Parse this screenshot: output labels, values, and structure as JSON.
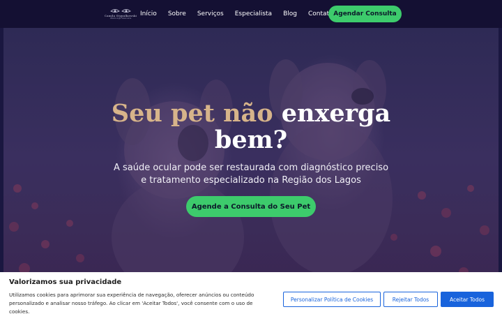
{
  "brand": {
    "logo_text": "Camila Stypulkowski",
    "logo_subtext": "Oftalmologia Veterinária"
  },
  "nav": {
    "items": [
      {
        "label": "Início"
      },
      {
        "label": "Sobre"
      },
      {
        "label": "Serviços"
      },
      {
        "label": "Especialista"
      },
      {
        "label": "Blog"
      },
      {
        "label": "Contato"
      }
    ],
    "cta_label": "Agendar Consulta"
  },
  "hero": {
    "title_accent": "Seu pet não",
    "title_rest_1": "enxerga",
    "title_rest_2": "bem?",
    "subtitle": "A saúde ocular pode ser restaurada com diagnóstico preciso e tratamento especializado na Região dos Lagos",
    "cta_label": "Agende a Consulta do Seu Pet",
    "background_image": "two-golden-retriever-puppies-in-flower-field"
  },
  "cookie_banner": {
    "title": "Valorizamos sua privacidade",
    "text": "Utilizamos cookies para aprimorar sua experiência de navegação, oferecer anúncios ou conteúdo personalizado e analisar nosso tráfego. Ao clicar em 'Aceitar Todos', você consente com o uso de cookies.",
    "customize_label": "Personalizar Política de Cookies",
    "reject_label": "Rejeitar Todos",
    "accept_label": "Aceitar Todos"
  },
  "colors": {
    "nav_background": "#141033",
    "accent_green": "#3dcb6c",
    "title_gold": "#d7b48a",
    "cookie_blue": "#1863dc"
  }
}
